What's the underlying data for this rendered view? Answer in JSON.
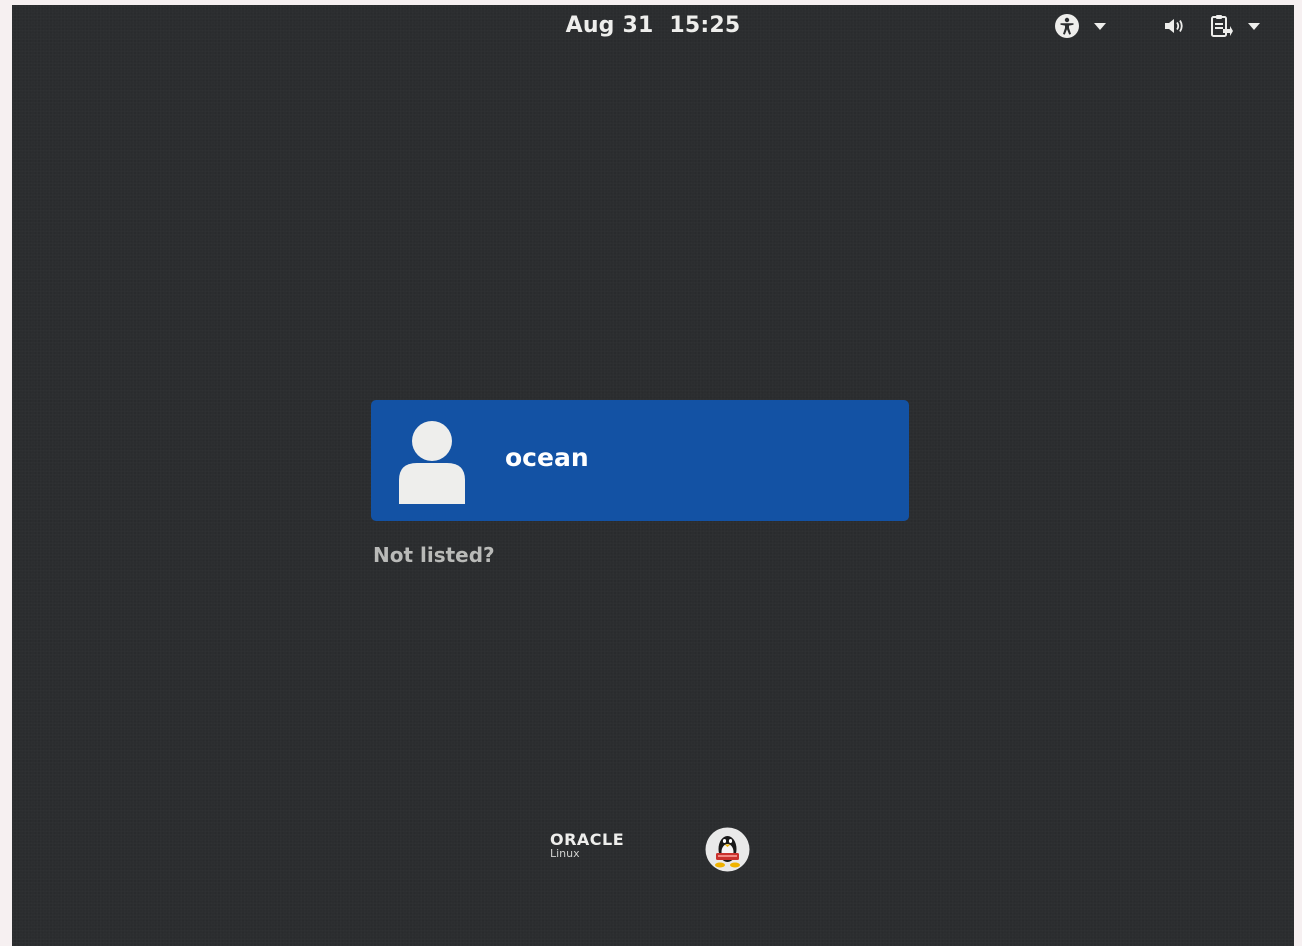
{
  "topbar": {
    "date": "Aug 31",
    "time": "15:25"
  },
  "icons": {
    "accessibility": "accessibility-icon",
    "volume": "volume-icon",
    "system": "system-menu-icon",
    "dropdown": "chevron-down-icon",
    "avatar": "user-avatar-icon",
    "tux": "tux-penguin-icon"
  },
  "user_list": {
    "users": [
      {
        "name": "ocean"
      }
    ],
    "not_listed": "Not listed?"
  },
  "branding": {
    "oracle": "ORACLE",
    "product": "Linux"
  },
  "colors": {
    "background": "#2b2d2f",
    "selected_user": "#1352a4",
    "text": "#eeeeec",
    "muted_text": "#b9bab8"
  }
}
